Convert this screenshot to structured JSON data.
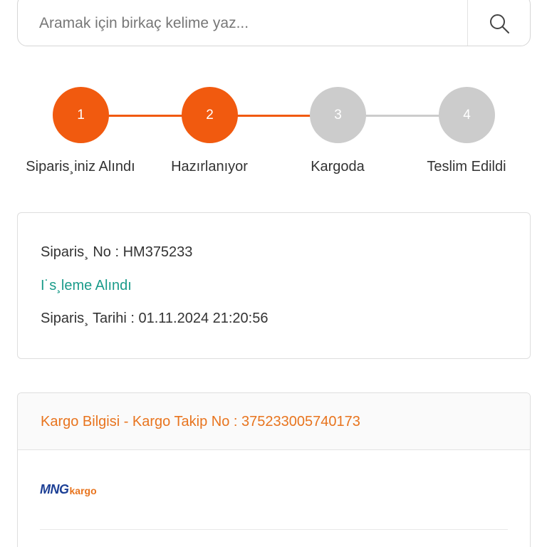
{
  "search": {
    "placeholder": "Aramak için birkaç kelime yaz..."
  },
  "steps": [
    {
      "number": "1",
      "label": "Siparis¸iniz Alındı",
      "active": true
    },
    {
      "number": "2",
      "label": "Hazırlanıyor",
      "active": true
    },
    {
      "number": "3",
      "label": "Kargoda",
      "active": false
    },
    {
      "number": "4",
      "label": "Teslim Edildi",
      "active": false
    }
  ],
  "order": {
    "number_line": "Siparis¸ No : HM375233",
    "status": "I˙s¸leme Alındı",
    "date_line": "Siparis¸ Tarihi : 01.11.2024 21:20:56"
  },
  "cargo": {
    "title": "Kargo Bilgisi - Kargo Takip No : 375233005740173",
    "logo": {
      "mng": "MNG",
      "kargo": "kargo"
    }
  },
  "colors": {
    "accent": "#f15a0f",
    "inactive": "#cccccc",
    "status": "#1a9b8a",
    "cargo_title": "#e8741e",
    "logo_blue": "#1c3f95"
  }
}
